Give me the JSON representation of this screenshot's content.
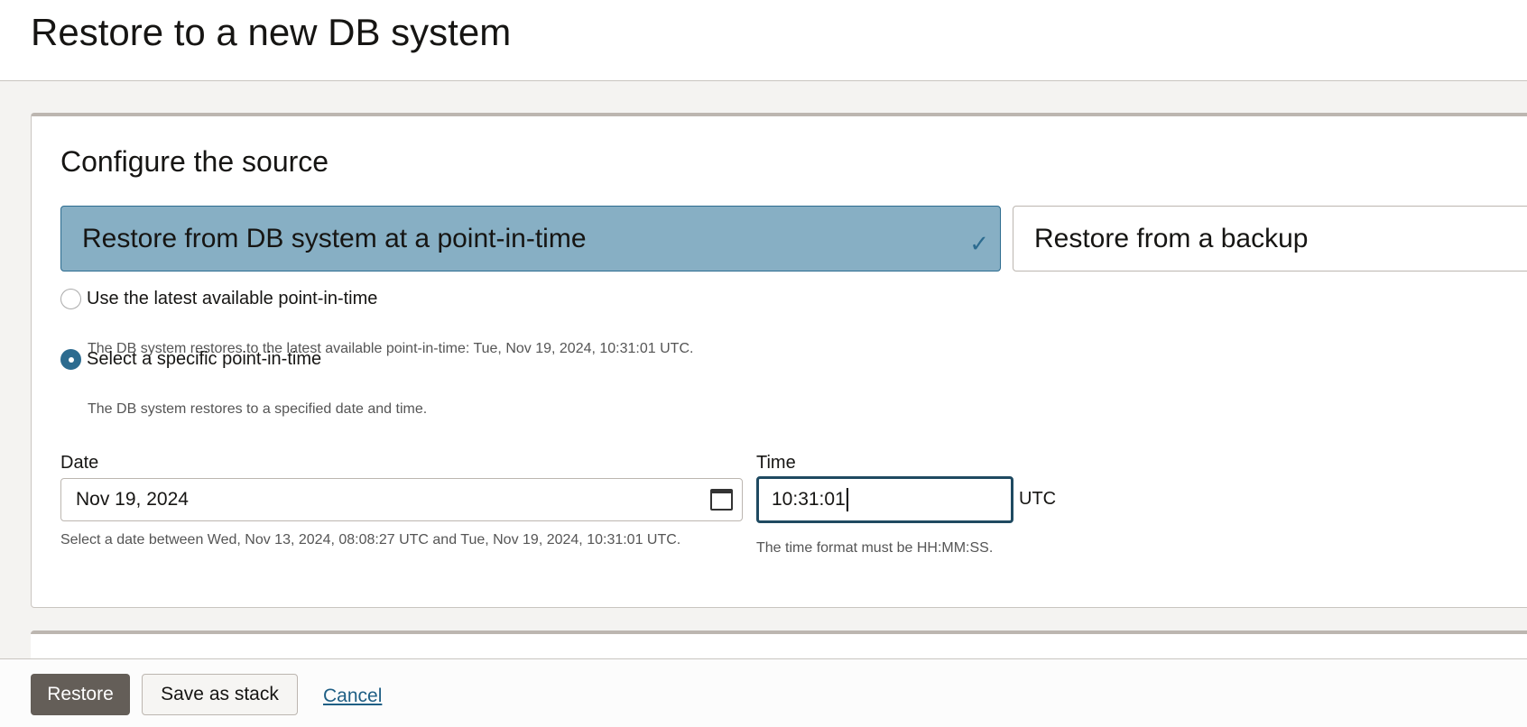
{
  "header": {
    "title": "Restore to a new DB system"
  },
  "source": {
    "title": "Configure the source",
    "tiles": [
      {
        "label": "Restore from DB system at a point-in-time",
        "selected": true
      },
      {
        "label": "Restore from a backup",
        "selected": false
      }
    ],
    "options": [
      {
        "label": "Use the latest available point-in-time",
        "description": "The DB system restores to the latest available point-in-time: Tue, Nov 19, 2024, 10:31:01 UTC.",
        "checked": false
      },
      {
        "label": "Select a specific point-in-time",
        "description": "The DB system restores to a specified date and time.",
        "checked": true
      }
    ],
    "date": {
      "label": "Date",
      "value": "Nov 19, 2024",
      "help": "Select a date between Wed, Nov 13, 2024, 08:08:27 UTC and Tue, Nov 19, 2024, 10:31:01 UTC."
    },
    "time": {
      "label": "Time",
      "value": "10:31:01",
      "suffix": "UTC",
      "help": "The time format must be HH:MM:SS."
    }
  },
  "footer": {
    "restore": "Restore",
    "save_stack": "Save as stack",
    "cancel": "Cancel"
  }
}
